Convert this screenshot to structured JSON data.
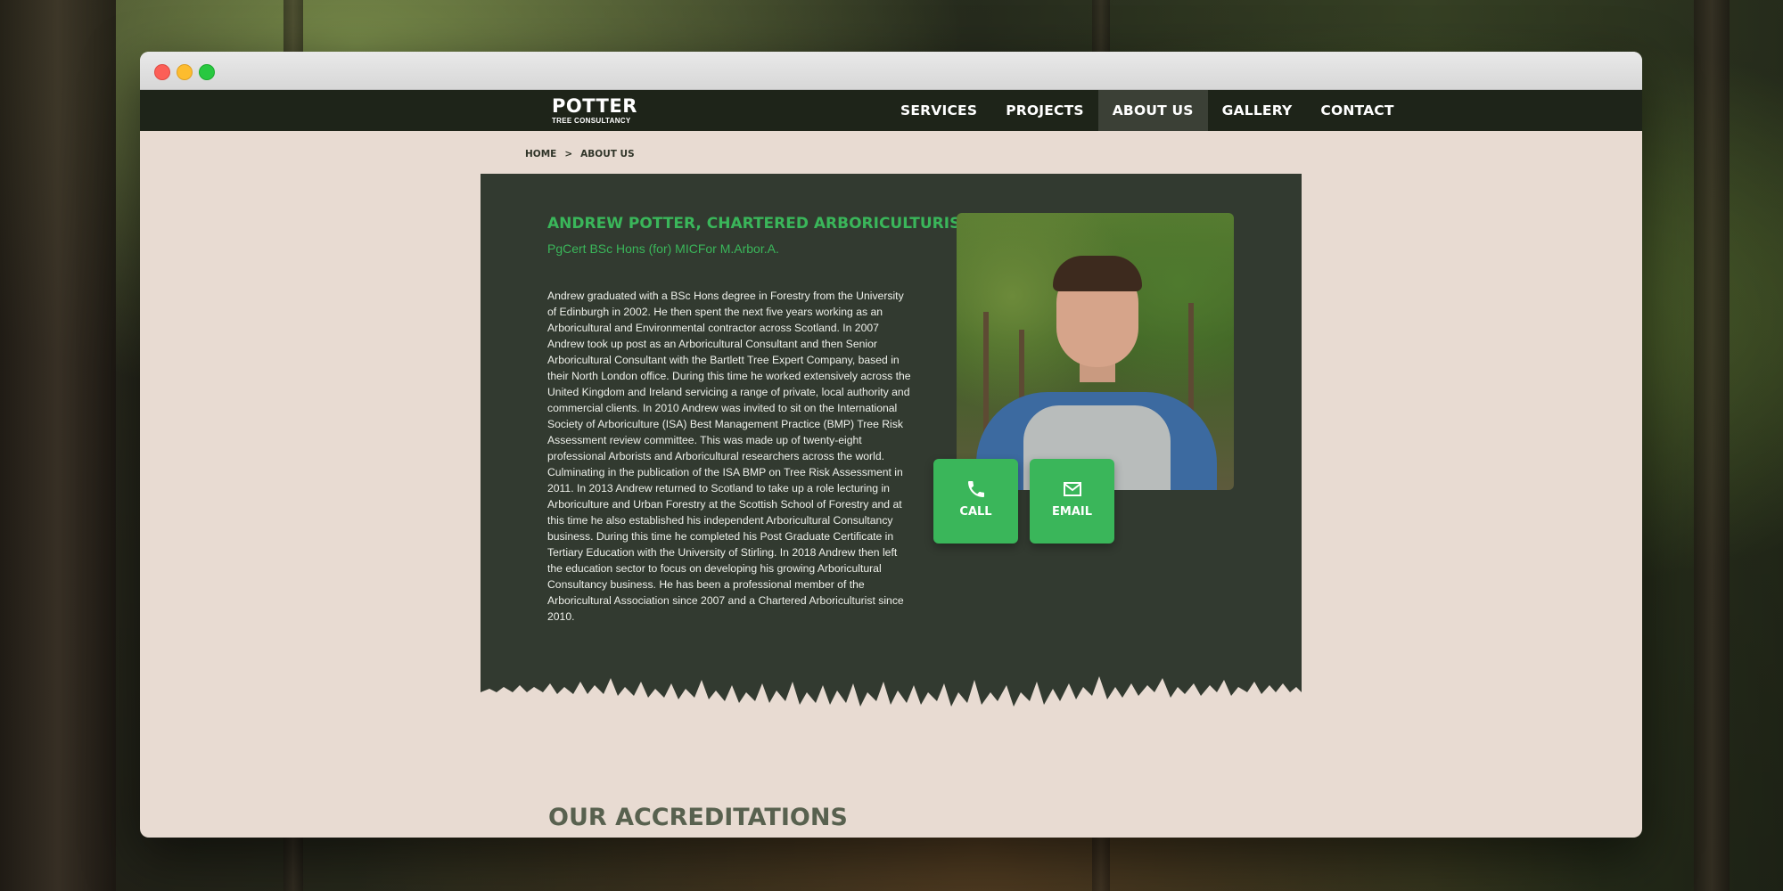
{
  "site": {
    "logo_main": "POTTER",
    "logo_sub": "TREE CONSULTANCY"
  },
  "nav": {
    "items": [
      {
        "label": "Services"
      },
      {
        "label": "Projects"
      },
      {
        "label": "About Us"
      },
      {
        "label": "Gallery"
      },
      {
        "label": "Contact"
      }
    ],
    "active": "About Us"
  },
  "breadcrumb": {
    "home": "HOME",
    "separator": ">",
    "current": "ABOUT US"
  },
  "profile": {
    "name": "Andrew Potter, Chartered Arboriculturist",
    "credentials": "PgCert BSc Hons (for) MICFor M.Arbor.A.",
    "bio": "Andrew graduated with a BSc Hons degree in Forestry from the University of Edinburgh in 2002. He then spent the next five years working as an Arboricultural and Environmental contractor across Scotland. In 2007 Andrew took up post as an Arboricultural Consultant and then Senior Arboricultural Consultant with the Bartlett Tree Expert Company, based in their North London office. During this time he worked extensively across the United Kingdom and Ireland servicing a range of private, local authority and commercial clients. In 2010 Andrew was invited to sit on the International Society of Arboriculture (ISA) Best Management Practice (BMP) Tree Risk Assessment review committee. This was made up of twenty-eight professional Arborists and Arboricultural researchers across the world. Culminating in the publication of the ISA BMP on Tree Risk Assessment in 2011. In 2013 Andrew returned to Scotland to take up a role lecturing in Arboriculture and Urban Forestry at the Scottish School of Forestry and at this time he also established his independent Arboricultural Consultancy business. During this time he completed his Post Graduate Certificate in Tertiary Education with the University of Stirling. In 2018 Andrew then left the education sector to focus on developing his growing Arboricultural Consultancy business. He has been a professional member of the Arboricultural Association since 2007 and a Chartered Arboriculturist since 2010.",
    "call_label": "Call",
    "email_label": "Email",
    "call_icon": "phone-icon",
    "email_icon": "mail-icon"
  },
  "accreditations": {
    "title": "Our Accreditations"
  },
  "colors": {
    "accent_green": "#3ab65a",
    "card_bg": "#323a30",
    "nav_bg": "#1e2419",
    "page_bg": "#e8dbd2"
  }
}
